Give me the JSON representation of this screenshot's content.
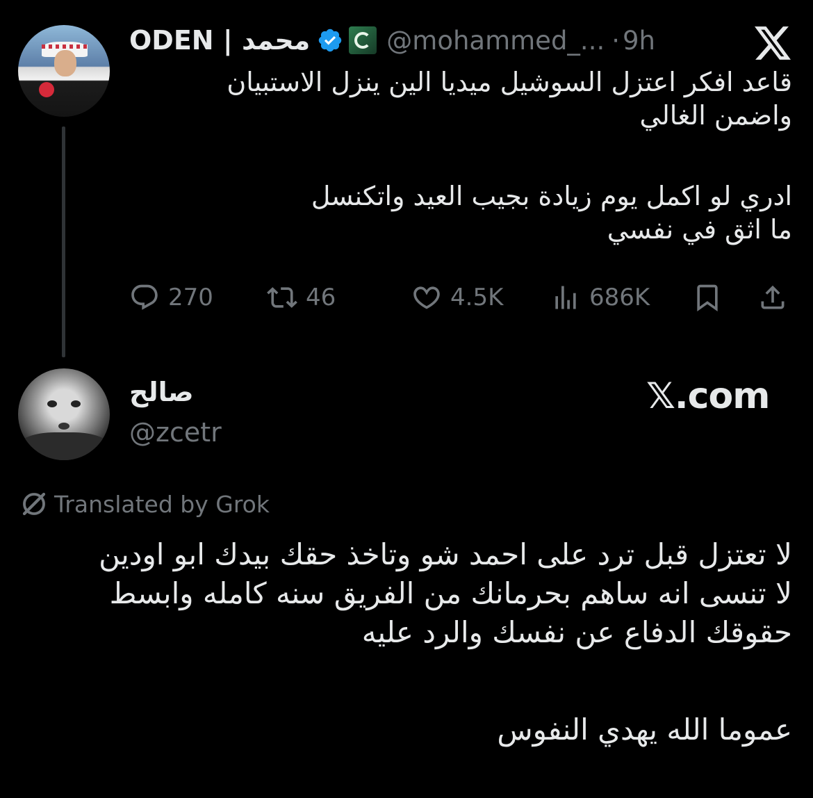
{
  "parent_tweet": {
    "display_name": "ODEN | محمد",
    "handle": "@mohammed_...",
    "separator": "·",
    "time": "9h",
    "text_lines": [
      "قاعد افكر اعتزل السوشيل ميديا الين ينزل الاستبيان",
      "واضمن الغالي",
      "ادري لو اكمل يوم زيادة بجيب العيد واتكنسل",
      "ما اثق في نفسي"
    ],
    "stats": {
      "replies": "270",
      "reposts": "46",
      "likes": "4.5K",
      "views": "686K"
    }
  },
  "reply": {
    "display_name": "صالح",
    "handle": "@zcetr",
    "site_label": "𝕏.com",
    "translated_label": "Translated by Grok",
    "text_lines": [
      "لا تعتزل قبل ترد على احمد شو وتاخذ حقك بيدك ابو اودين",
      "لا تنسى انه ساهم بحرمانك من الفريق سنه كامله وابسط",
      "حقوقك الدفاع عن نفسك والرد عليه",
      "عموما الله يهدي النفوس"
    ]
  },
  "colors": {
    "background": "#000000",
    "text": "#e7e9ea",
    "muted": "#71767b",
    "verified": "#1d9bf0",
    "thread_line": "#2f3336"
  }
}
